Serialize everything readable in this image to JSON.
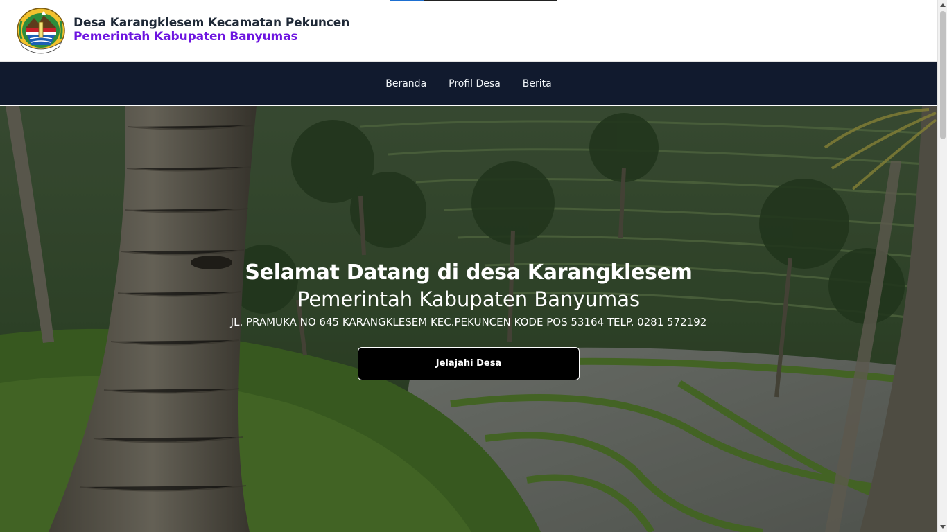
{
  "header": {
    "title": "Desa Karangklesem Kecamatan Pekuncen",
    "subtitle": "Pemerintah Kabupaten Banyumas",
    "logo_icon": "banyumas-regency-emblem",
    "subtitle_color": "#6d14e0"
  },
  "nav": {
    "items": [
      {
        "label": "Beranda"
      },
      {
        "label": "Profil Desa"
      },
      {
        "label": "Berita"
      }
    ],
    "background": "#111a2e"
  },
  "hero": {
    "title": "Selamat Datang di desa Karangklesem",
    "subtitle": "Pemerintah Kabupaten Banyumas",
    "address": "JL. PRAMUKA NO 645 KARANGKLESEM KEC.PEKUNCEN KODE POS 53164 TELP. 0281 572192",
    "cta_label": "Jelajahi Desa",
    "background_image": "rice-terrace-palm-trees-photo"
  }
}
